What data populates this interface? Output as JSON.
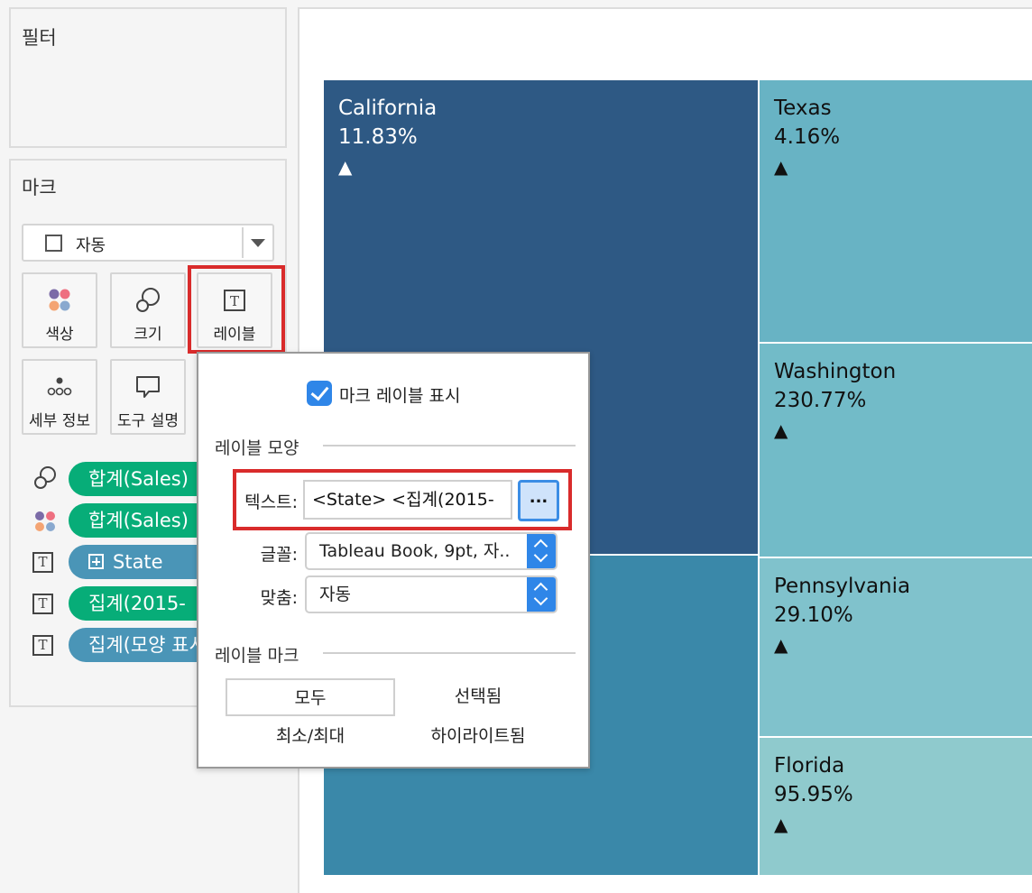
{
  "panels": {
    "filters_title": "필터",
    "marks_title": "마크",
    "mark_type": "자동"
  },
  "mark_buttons": {
    "color": "색상",
    "size": "크기",
    "label": "레이블",
    "detail": "세부 정보",
    "tooltip": "도구 설명"
  },
  "pills": [
    {
      "text": "합계(Sales)",
      "icon": "size-icon",
      "color": "#07ad78"
    },
    {
      "text": "합계(Sales)",
      "icon": "color-icon",
      "color": "#07ad78"
    },
    {
      "text": "State",
      "icon": "text-icon",
      "color": "#4a95b7"
    },
    {
      "text": "집계(2015-",
      "icon": "text-icon",
      "color": "#07ad78"
    },
    {
      "text": "집계(모양 표시",
      "icon": "text-icon",
      "color": "#4a95b7"
    }
  ],
  "treemap": {
    "tiles": [
      {
        "name": "California",
        "pct": "11.83%",
        "tri": "▲",
        "color": "#2e5984"
      },
      {
        "name": "Texas",
        "pct": "4.16%",
        "tri": "▲",
        "color": "#68b3c4"
      },
      {
        "name": "Washington",
        "pct": "230.77%",
        "tri": "▲",
        "color": "#72bbc8"
      },
      {
        "name": "Pennsylvania",
        "pct": "29.10%",
        "tri": "▲",
        "color": "#80c2cc"
      },
      {
        "name": "Florida",
        "pct": "95.95%",
        "tri": "▲",
        "color": "#8fcacd"
      },
      {
        "name": "",
        "pct": "",
        "tri": "",
        "color": "#3a88a9"
      }
    ]
  },
  "popup": {
    "show_labels": "마크 레이블 표시",
    "appearance_title": "레이블 모양",
    "text_label": "텍스트:",
    "text_value": "<State>  <집계(2015-",
    "ellipsis": "...",
    "font_label": "글꼴:",
    "font_value": "Tableau Book, 9pt, 자..",
    "align_label": "맞춤:",
    "align_value": "자동",
    "marks_title": "레이블 마크",
    "options": [
      "모두",
      "선택됨",
      "최소/최대",
      "하이라이트됨"
    ]
  }
}
